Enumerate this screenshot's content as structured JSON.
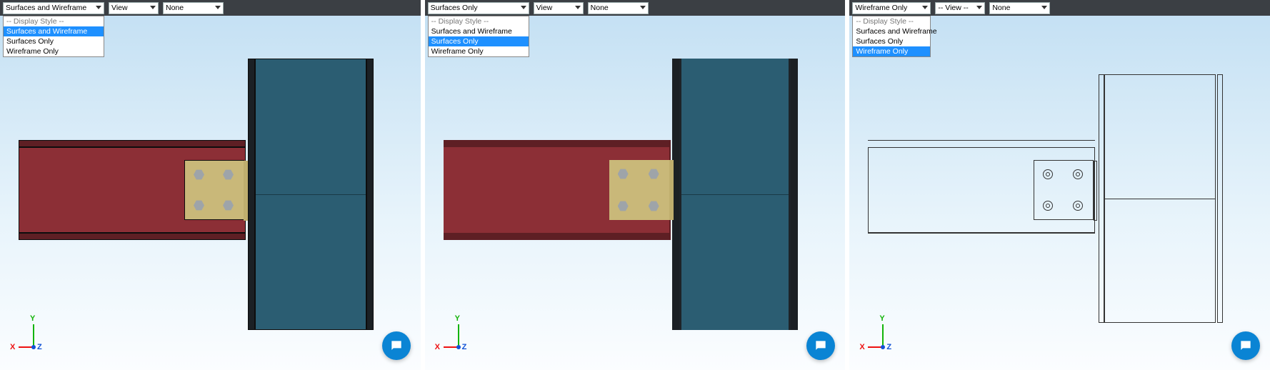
{
  "display_style_options": {
    "header": "-- Display Style --",
    "items": [
      "Surfaces and Wireframe",
      "Surfaces Only",
      "Wireframe Only"
    ]
  },
  "view_placeholder": "-- View --",
  "none_placeholder": "None",
  "axes": {
    "x": "X",
    "y": "Y",
    "z": "Z"
  },
  "panel1": {
    "style_selected": "Surfaces and Wireframe",
    "view_selected": "View",
    "none_selected": "None",
    "highlight_index": 0
  },
  "panel2": {
    "style_selected": "Surfaces Only",
    "view_selected": "View",
    "none_selected": "None",
    "highlight_index": 1
  },
  "panel3": {
    "style_selected": "Wireframe Only",
    "view_selected": "-- View --",
    "none_selected": "None",
    "highlight_index": 2
  }
}
